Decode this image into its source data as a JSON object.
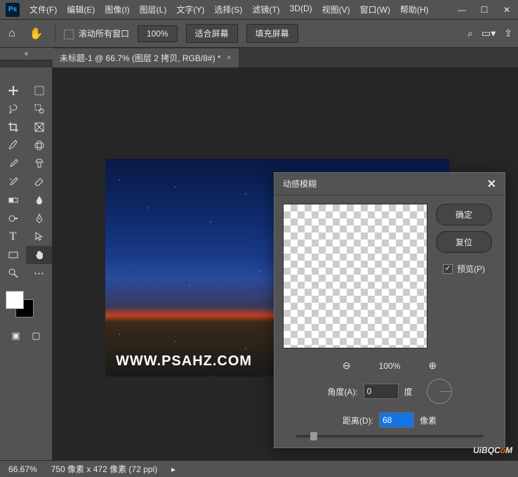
{
  "menubar": {
    "file": "文件(F)",
    "edit": "编辑(E)",
    "image": "图像(I)",
    "layer": "图层(L)",
    "type": "文字(Y)",
    "select": "选择(S)",
    "filter": "滤镜(T)",
    "threeD": "3D(D)",
    "view": "视图(V)",
    "window": "窗口(W)",
    "help": "帮助(H)"
  },
  "window_controls": {
    "min": "—",
    "max": "☐",
    "close": "✕"
  },
  "optionbar": {
    "scroll_all": "滚动所有窗口",
    "zoom_value": "100%",
    "fit_screen": "适合屏幕",
    "fill_screen": "填充屏幕"
  },
  "tabs": {
    "active": "未标题-1 @ 66.7% (图层 2 拷贝, RGB/8#) *"
  },
  "tools": {
    "move": "✥",
    "marquee": "▭",
    "lasso": "⌇",
    "quick_select": "✶",
    "crop": "✂",
    "slice": "▧",
    "eyedropper": "✎",
    "spot_heal": "◉",
    "brush": "✐",
    "clone": "⟐",
    "history": "↺",
    "eraser": "◨",
    "gradient": "▤",
    "blur": "●",
    "dodge": "◐",
    "pen": "✒",
    "text": "T",
    "path": "↖",
    "shape": "▭",
    "hand": "✋",
    "zoom": "⌕",
    "more": "⋯"
  },
  "canvas": {
    "watermark": "WWW.PSAHZ.COM"
  },
  "dialog": {
    "title": "动感模糊",
    "ok": "确定",
    "cancel": "复位",
    "preview_label": "预览(P)",
    "zoom_value": "100%",
    "angle_label": "角度(A):",
    "angle_value": "0",
    "angle_unit": "度",
    "distance_label": "距离(D):",
    "distance_value": "68",
    "distance_unit": "像素"
  },
  "statusbar": {
    "zoom": "66.67%",
    "doc_info": "750 像素 x 472 像素 (72 ppi)"
  },
  "brand": {
    "pre": "UiB",
    "mid": "Q",
    ".": ".",
    "c": "C",
    "o": "o",
    "m": "M"
  }
}
